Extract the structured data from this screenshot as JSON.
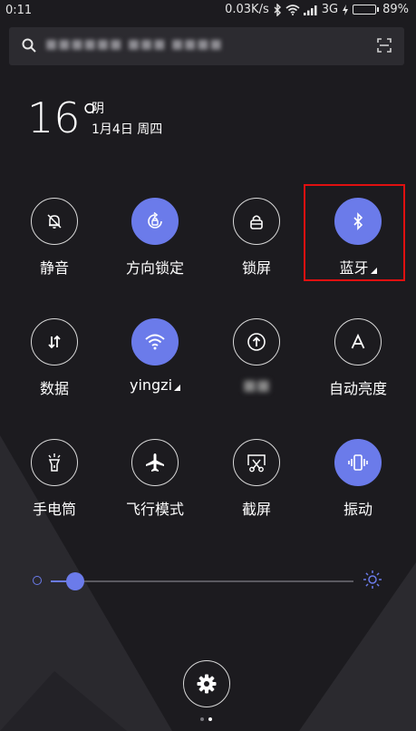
{
  "status": {
    "time": "0:11",
    "speed": "0.03K/s",
    "network": "3G",
    "battery_text": "89%",
    "battery_level": 0.89
  },
  "search": {
    "text": "■■■■■■  ■■■ ■■■■"
  },
  "weather": {
    "temp": "16",
    "unit": "°",
    "condition": "阴",
    "date": "1月4日 周四"
  },
  "tiles": [
    {
      "label": "静音",
      "icon": "bell-off-icon",
      "active": false
    },
    {
      "label": "方向锁定",
      "icon": "rotation-lock-icon",
      "active": true
    },
    {
      "label": "锁屏",
      "icon": "lock-icon",
      "active": false
    },
    {
      "label": "蓝牙",
      "icon": "bluetooth-icon",
      "active": true
    },
    {
      "label": "数据",
      "icon": "data-arrows-icon",
      "active": false
    },
    {
      "label": "yingzi",
      "icon": "wifi-icon",
      "active": true
    },
    {
      "label": "■■",
      "icon": "upload-icon",
      "active": false
    },
    {
      "label": "自动亮度",
      "icon": "auto-brightness-icon",
      "active": false
    },
    {
      "label": "手电筒",
      "icon": "flashlight-icon",
      "active": false
    },
    {
      "label": "飞行模式",
      "icon": "airplane-icon",
      "active": false
    },
    {
      "label": "截屏",
      "icon": "screenshot-icon",
      "active": false
    },
    {
      "label": "振动",
      "icon": "vibrate-icon",
      "active": true
    }
  ],
  "brightness": {
    "level": 0.08
  },
  "colors": {
    "accent": "#6b7bea",
    "background": "#1c1b1f",
    "highlight": "#e01010"
  }
}
